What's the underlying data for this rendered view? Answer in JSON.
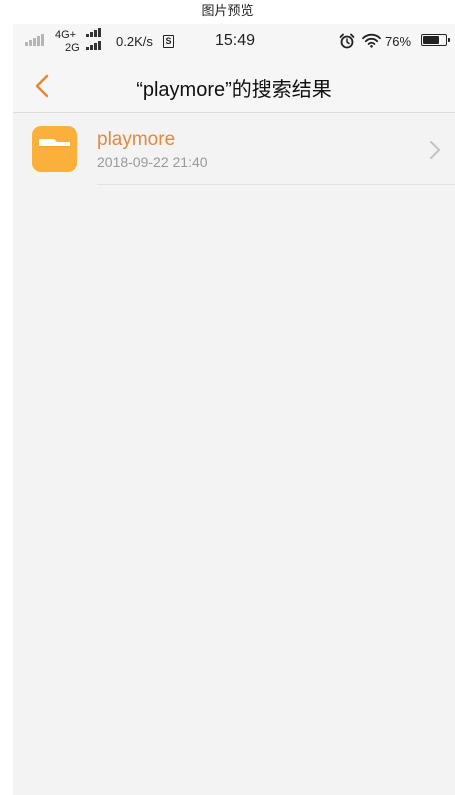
{
  "viewer": {
    "title": "图片预览"
  },
  "status_bar": {
    "network_primary": "4G+",
    "network_secondary": "2G",
    "speed": "0.2K/s",
    "speed_icon_letter": "S",
    "time": "15:49",
    "battery_percent": "76%",
    "battery_level": 0.76,
    "icons": [
      "signal-icon",
      "alarm-icon",
      "wifi-icon",
      "battery-icon"
    ]
  },
  "nav": {
    "title": "“playmore”的搜索结果",
    "back_icon": "chevron-left-icon"
  },
  "results": [
    {
      "name": "playmore",
      "date": "2018-09-22 21:40",
      "icon": "folder-icon"
    }
  ],
  "colors": {
    "accent": "#e18a3e",
    "folder": "#fbb03b",
    "background": "#f3f3f4"
  }
}
